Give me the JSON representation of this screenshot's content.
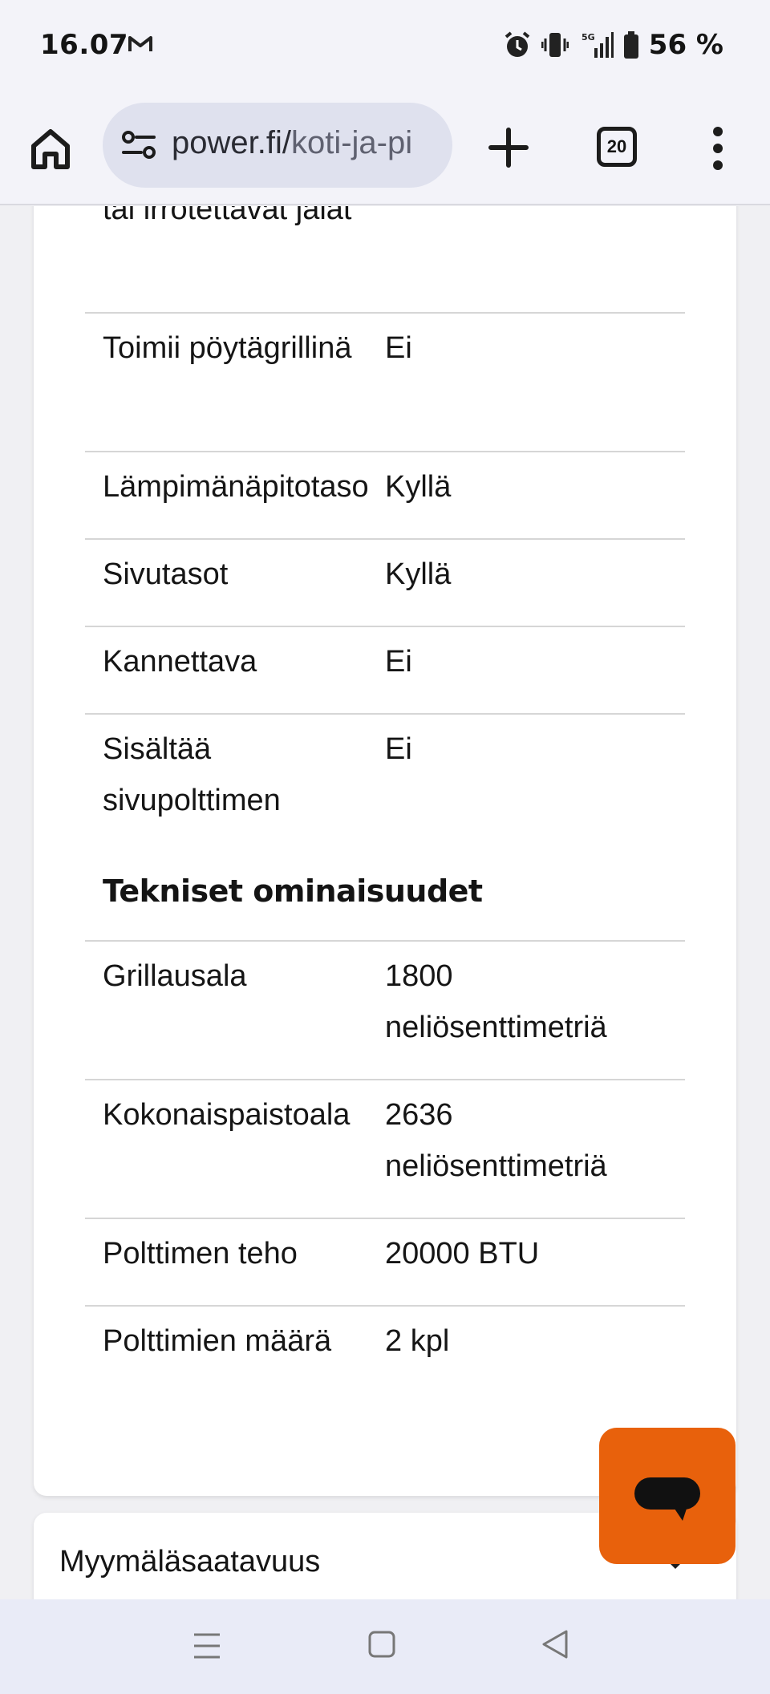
{
  "status": {
    "time": "16.07",
    "battery": "56 %",
    "network": "5G"
  },
  "browser": {
    "url_main": "power.fi/",
    "url_rest": "koti-ja-pi",
    "tab_count": "20"
  },
  "specs_top": [
    {
      "label": "tai irrotettavat jalat",
      "value": ""
    },
    {
      "label": "Toimii pöytägrillinä",
      "value": "Ei"
    },
    {
      "label": "Lämpimänäpitotaso",
      "value": "Kyllä"
    },
    {
      "label": "Sivutasot",
      "value": "Kyllä"
    },
    {
      "label": "Kannettava",
      "value": "Ei"
    },
    {
      "label": "Sisältää sivupolttimen",
      "value": "Ei"
    }
  ],
  "section_heading": "Tekniset ominaisuudet",
  "specs_tech": [
    {
      "label": "Grillausala",
      "value": "1800 neliösenttimetriä"
    },
    {
      "label": "Kokonaispaistoala",
      "value": "2636 neliösenttimetriä"
    },
    {
      "label": "Polttimen teho",
      "value": "20000 BTU"
    },
    {
      "label": "Polttimien määrä",
      "value": "2 kpl"
    }
  ],
  "store_availability": "Myymäläsaatavuus",
  "colors": {
    "chat_button": "#e8610c",
    "url_bar": "#dfe1ee"
  }
}
